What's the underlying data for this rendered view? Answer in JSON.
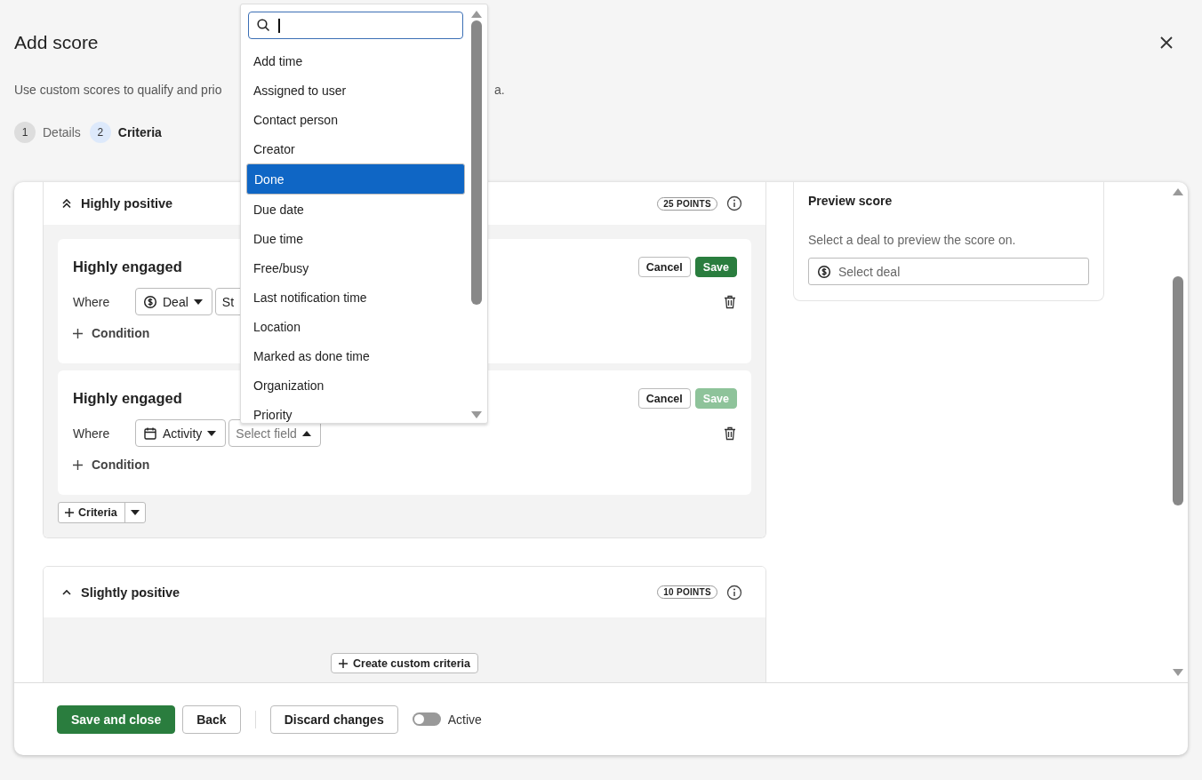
{
  "dialog": {
    "title": "Add score",
    "description_start": "Use custom scores to qualify and prio",
    "description_end": "a."
  },
  "steps": [
    {
      "number": "1",
      "label": "Details",
      "selected": false
    },
    {
      "number": "2",
      "label": "Criteria",
      "selected": true
    }
  ],
  "sections": [
    {
      "title": "Highly positive",
      "points": "25 POINTS",
      "expanded": true,
      "add_criteria": "Criteria",
      "rules": [
        {
          "title": "Highly engaged",
          "where": "Where",
          "entity": {
            "kind": "deal",
            "label": "Deal"
          },
          "field": {
            "value": "St"
          },
          "cancel": "Cancel",
          "save": "Save",
          "save_disabled": false,
          "add_condition": "Condition"
        },
        {
          "title": "Highly engaged",
          "where": "Where",
          "entity": {
            "kind": "activity",
            "label": "Activity"
          },
          "field": {
            "placeholder": "Select field",
            "open": true
          },
          "cancel": "Cancel",
          "save": "Save",
          "save_disabled": true,
          "add_condition": "Condition"
        }
      ]
    },
    {
      "title": "Slightly positive",
      "points": "10 POINTS",
      "expanded": true,
      "create": "Create custom criteria"
    }
  ],
  "preview": {
    "title": "Preview score",
    "text": "Select a deal to preview the score on.",
    "select_placeholder": "Select deal"
  },
  "footer": {
    "save": "Save and close",
    "back": "Back",
    "discard": "Discard changes",
    "active_label": "Active",
    "active_on": false
  },
  "dropdown": {
    "items": [
      {
        "label": "Add time",
        "selected": false
      },
      {
        "label": "Assigned to user",
        "selected": false
      },
      {
        "label": "Contact person",
        "selected": false
      },
      {
        "label": "Creator",
        "selected": false
      },
      {
        "label": "Done",
        "selected": true
      },
      {
        "label": "Due date",
        "selected": false
      },
      {
        "label": "Due time",
        "selected": false
      },
      {
        "label": "Free/busy",
        "selected": false
      },
      {
        "label": "Last notification time",
        "selected": false
      },
      {
        "label": "Location",
        "selected": false
      },
      {
        "label": "Marked as done time",
        "selected": false
      },
      {
        "label": "Organization",
        "selected": false
      },
      {
        "label": "Priority",
        "selected": false
      }
    ]
  }
}
